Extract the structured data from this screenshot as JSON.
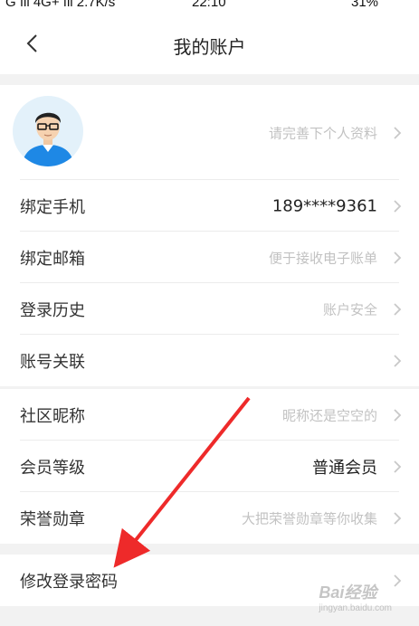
{
  "status_bar": {
    "network": "G  ıll  4G+ ıll  2.7K/s",
    "time": "22:10",
    "battery": "31%"
  },
  "header": {
    "title": "我的账户",
    "back_icon": "chevron-left-icon"
  },
  "profile": {
    "hint": "请完善下个人资料"
  },
  "account_section": [
    {
      "label": "绑定手机",
      "value": "189****9361",
      "emphasis": true
    },
    {
      "label": "绑定邮箱",
      "value": "便于接收电子账单",
      "emphasis": false
    },
    {
      "label": "登录历史",
      "value": "账户安全",
      "emphasis": false
    },
    {
      "label": "账号关联",
      "value": "",
      "emphasis": false
    }
  ],
  "community_section": [
    {
      "label": "社区昵称",
      "value": "昵称还是空空的",
      "emphasis": false
    },
    {
      "label": "会员等级",
      "value": "普通会员",
      "emphasis": true
    },
    {
      "label": "荣誉勋章",
      "value": "大把荣誉勋章等你收集",
      "emphasis": false
    }
  ],
  "password_section": [
    {
      "label": "修改登录密码",
      "value": "",
      "emphasis": false
    }
  ],
  "annotation": {
    "arrow_color": "#ee2a2a"
  },
  "watermark": {
    "text": "Bai经验",
    "sub": "jingyan.baidu.com"
  }
}
